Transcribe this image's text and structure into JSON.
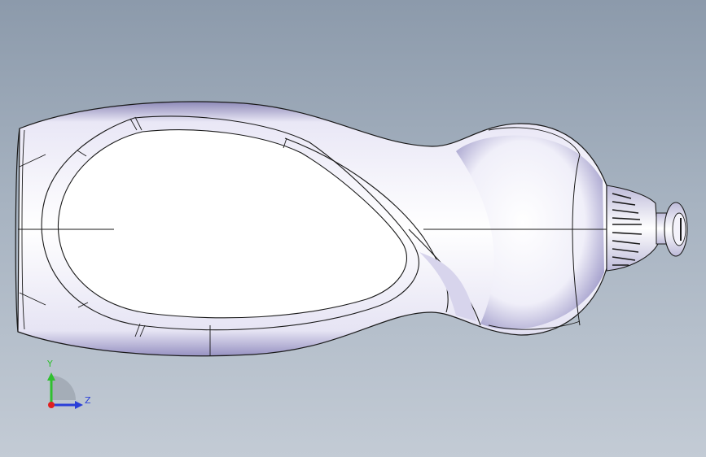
{
  "viewport": {
    "background_top": "#8c9aab",
    "background_bottom": "#c3cbd5"
  },
  "model": {
    "name": "bottle",
    "fill": "#f4f3fb",
    "edge_color": "#1a1a1a",
    "shade_color": "#b9b6d8"
  },
  "triad": {
    "y_label": "Y",
    "z_label": "Z",
    "y_color": "#2fbf2f",
    "z_color": "#2a3fd8",
    "x_color": "#e02020"
  }
}
